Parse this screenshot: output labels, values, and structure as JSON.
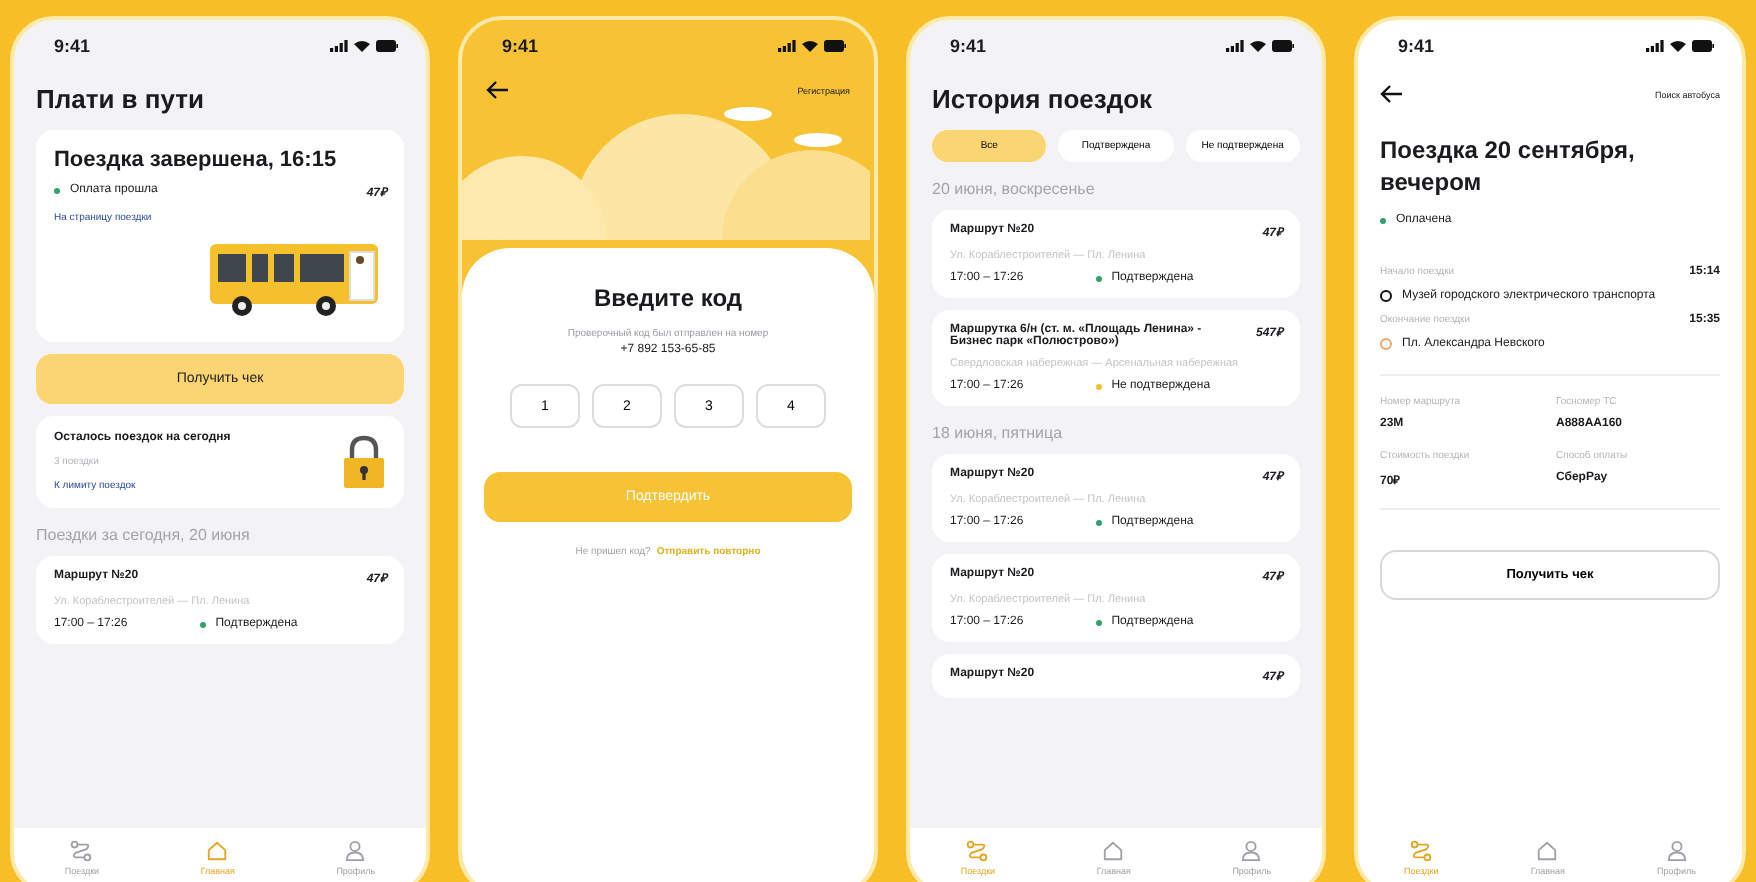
{
  "home": {
    "status_bar": {
      "time": "9:41"
    },
    "title": "Плати в пути",
    "trip_card": {
      "title": "Поездка завершена, 16:15",
      "status": "Оплата прошла",
      "color": "#2fa36b",
      "price": "47₽",
      "link": "На страницу поездки"
    },
    "receipt_button": "Получить чек",
    "limit_card": {
      "title": "Осталось поездок на сегодня",
      "subtitle": "3 поездки",
      "link": "К лимиту поездок"
    },
    "section_title": "Поездки за сегодня, 20 июня",
    "trips": [
      {
        "route": "Маршрут №20",
        "price": "47₽",
        "stops": "Ул. Кораблестроителей — Пл. Ленина",
        "time": "17:00 – 17:26",
        "status": "Подтверждена",
        "color": "#2fa36b"
      }
    ],
    "tab_bar": [
      {
        "kind": "trips",
        "label": "Поездки",
        "selected": false
      },
      {
        "kind": "home",
        "label": "Главная",
        "selected": true
      },
      {
        "kind": "profile",
        "label": "Профиль",
        "selected": false
      }
    ]
  },
  "code_entry": {
    "status_bar": {
      "time": "9:41"
    },
    "top_link": "Регистрация",
    "title": "Введите код",
    "hint": "Проверочный код был отправлен на номер",
    "phone": "+7 892 153-65-85",
    "code_digits": [
      "1",
      "2",
      "3",
      "4"
    ],
    "confirm_button": "Подтвердить",
    "resend_question": "Не пришел код?",
    "resend_link": "Отправить повторно"
  },
  "history": {
    "status_bar": {
      "time": "9:41"
    },
    "title": "История поездок",
    "filters": [
      {
        "label": "Все",
        "selected": true
      },
      {
        "label": "Подтверждена",
        "selected": false
      },
      {
        "label": "Не подтверждена",
        "selected": false
      }
    ],
    "sections": [
      {
        "title": "20 июня, воскресенье",
        "trips": [
          {
            "route": "Маршрут №20",
            "price": "47₽",
            "stops": "Ул. Кораблестроителей — Пл. Ленина",
            "time": "17:00 – 17:26",
            "status": "Подтверждена",
            "color": "#2fa36b"
          },
          {
            "route": "Маршрутка 6/н (ст. м. «Площадь Ленина» - Бизнес парк «Полюстрово»)",
            "price": "547₽",
            "stops": "Свердловская набережная — Арсенальная набережная",
            "time": "17:00 – 17:26",
            "status": "Не подтверждена",
            "color": "#f5c02c"
          }
        ]
      },
      {
        "title": "18 июня, пятница",
        "trips": [
          {
            "route": "Маршрут №20",
            "price": "47₽",
            "stops": "Ул. Кораблестроителей — Пл. Ленина",
            "time": "17:00 – 17:26",
            "status": "Подтверждена",
            "color": "#2fa36b"
          },
          {
            "route": "Маршрут №20",
            "price": "47₽",
            "stops": "Ул. Кораблестроителей — Пл. Ленина",
            "time": "17:00 – 17:26",
            "status": "Подтверждена",
            "color": "#2fa36b"
          },
          {
            "route": "Маршрут №20",
            "price": "47₽"
          }
        ]
      }
    ],
    "tab_bar": [
      {
        "kind": "trips",
        "label": "Поездки",
        "selected": true
      },
      {
        "kind": "home",
        "label": "Главная",
        "selected": false
      },
      {
        "kind": "profile",
        "label": "Профиль",
        "selected": false
      }
    ]
  },
  "trip_details": {
    "status_bar": {
      "time": "9:41"
    },
    "top_link": "Поиск автобуса",
    "title": "Поездка 20 сентября, вечером",
    "status": "Оплачена",
    "color": "#2fa36b",
    "start": {
      "label": "Начало поездки",
      "time": "15:14",
      "place": "Музей городского электрического транспорта"
    },
    "end": {
      "label": "Окончание поездки",
      "time": "15:35",
      "place": "Пл. Александра Невского"
    },
    "facts": [
      {
        "label": "Номер маршрута",
        "value": "23М"
      },
      {
        "label": "Госномер ТС",
        "value": "А888АА160"
      },
      {
        "label": "Стоимость поездки",
        "value": "70₽"
      },
      {
        "label": "Способ оплаты",
        "value": "СберPay"
      }
    ],
    "receipt_button": "Получить чек",
    "tab_bar": [
      {
        "kind": "trips",
        "label": "Поездки",
        "selected": true
      },
      {
        "kind": "home",
        "label": "Главная",
        "selected": false
      },
      {
        "kind": "profile",
        "label": "Профиль",
        "selected": false
      }
    ]
  }
}
